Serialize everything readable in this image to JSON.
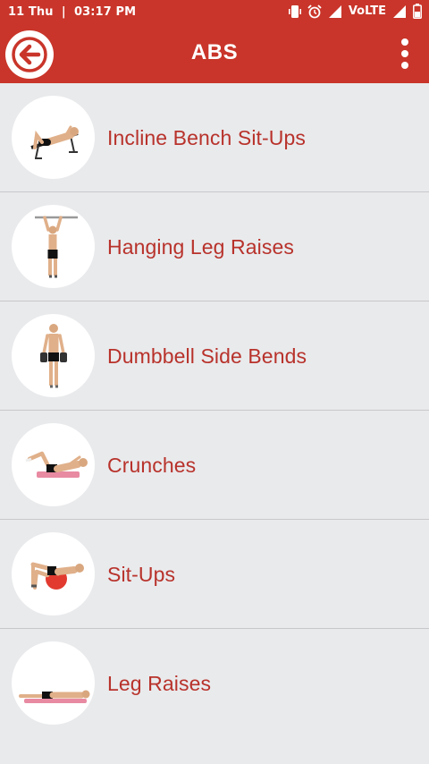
{
  "status_bar": {
    "left_text": "11 Thu  |  03:17 PM",
    "network_label": "VoLTE",
    "icons": [
      "vibrate-icon",
      "alarm-icon",
      "signal-icon",
      "volte-signal-icon",
      "battery-icon"
    ]
  },
  "app_bar": {
    "title": "ABS",
    "back_icon": "back-arrow-icon",
    "menu_icon": "more-vert-icon"
  },
  "colors": {
    "primary": "#c9352a",
    "label": "#b8322b",
    "background": "#e9eaec",
    "divider": "#c8c8cc"
  },
  "exercises": [
    {
      "label": "Incline Bench Sit-Ups",
      "image": "incline-bench-situp-illustration"
    },
    {
      "label": "Hanging Leg Raises",
      "image": "hanging-leg-raise-illustration"
    },
    {
      "label": "Dumbbell Side Bends",
      "image": "dumbbell-side-bend-illustration"
    },
    {
      "label": "Crunches",
      "image": "crunch-illustration"
    },
    {
      "label": "Sit-Ups",
      "image": "situp-ball-illustration"
    },
    {
      "label": "Leg Raises",
      "image": "leg-raise-illustration"
    }
  ]
}
